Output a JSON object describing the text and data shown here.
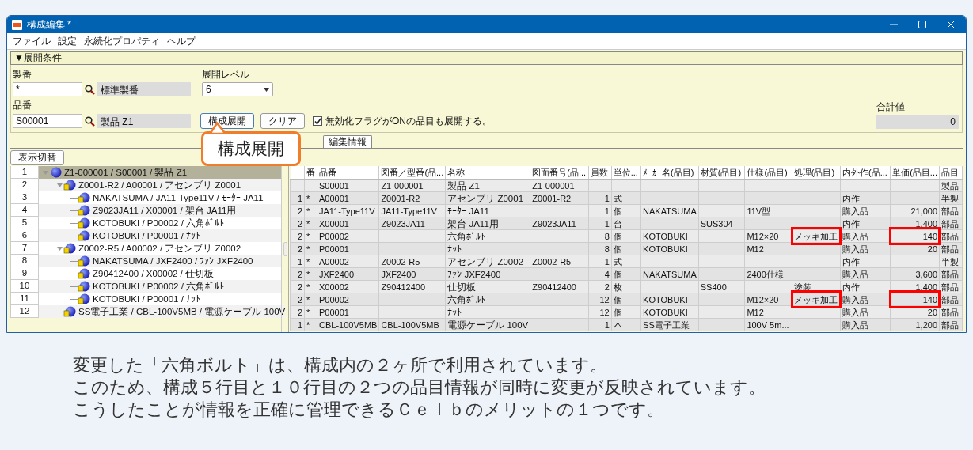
{
  "window": {
    "title": "構成編集 *"
  },
  "menu": [
    "ファイル",
    "設定",
    "永続化プロパティ",
    "ヘルプ"
  ],
  "conditions": {
    "header": "▼展開条件",
    "seiban": {
      "label": "製番",
      "value": "*",
      "name": "標準製番"
    },
    "level": {
      "label": "展開レベル",
      "value": "6"
    },
    "hinban": {
      "label": "品番",
      "value": "S00001",
      "name": "製品 Z1"
    },
    "buttons": [
      "構成展開",
      "クリア"
    ],
    "checkbox": {
      "label": "無効化フラグがONの品目も展開する。",
      "checked": true
    },
    "total": {
      "label": "合計値",
      "value": "0"
    }
  },
  "callout": {
    "text": "構成展開"
  },
  "tabs": [
    {
      "label": "編集情報",
      "selected": false
    }
  ],
  "toggle_button": "表示切替",
  "tree": [
    {
      "row": "1",
      "text": "Z1-000001 / S00001 / 製品 Z1",
      "kind": "product",
      "selected": true,
      "expanded": true,
      "children": [
        {
          "row": "2",
          "text": "Z0001-R2 / A00001 / アセンブリ Z0001",
          "kind": "part",
          "selected": false,
          "expanded": true,
          "children": [
            {
              "row": "3",
              "text": "NAKATSUMA / JA11-Type11V / ﾓｰﾀｰ JA11",
              "kind": "part",
              "selected": false
            },
            {
              "row": "4",
              "text": "Z9023JA11 / X00001 / 架台 JA11用",
              "kind": "part",
              "selected": false
            },
            {
              "row": "5",
              "text": "KOTOBUKI / P00002 / 六角ﾎﾞﾙﾄ",
              "kind": "part",
              "selected": false
            },
            {
              "row": "6",
              "text": "KOTOBUKI / P00001 / ﾅｯﾄ",
              "kind": "part",
              "selected": false
            }
          ]
        },
        {
          "row": "7",
          "text": "Z0002-R5 / A00002 / アセンブリ Z0002",
          "kind": "part",
          "selected": false,
          "expanded": true,
          "children": [
            {
              "row": "8",
              "text": "NAKATSUMA / JXF2400 / ﾌｧﾝ JXF2400",
              "kind": "part",
              "selected": false
            },
            {
              "row": "9",
              "text": "Z90412400 / X00002 / 仕切板",
              "kind": "part",
              "selected": false
            },
            {
              "row": "10",
              "text": "KOTOBUKI / P00002 / 六角ﾎﾞﾙﾄ",
              "kind": "part",
              "selected": false
            },
            {
              "row": "11",
              "text": "KOTOBUKI / P00001 / ﾅｯﾄ",
              "kind": "part",
              "selected": false
            }
          ]
        },
        {
          "row": "12",
          "text": "SS電子工業 / CBL-100V5MB / 電源ケーブル 100V",
          "kind": "part",
          "selected": false
        }
      ]
    }
  ],
  "table": {
    "columns": [
      null,
      "番",
      "品番",
      "図番／型番(品...",
      "名称",
      "図面番号(品...",
      "員数",
      "単位...",
      "ﾒｰｶｰ名(品目)",
      "材質(品目)",
      "仕様(品目)",
      "処理(品目)",
      "内外作(品...",
      "単価(品目...",
      "品目"
    ],
    "rows": [
      {
        "cells": [
          null,
          null,
          "S00001",
          "Z1-000001",
          "製品 Z1",
          "Z1-000001",
          null,
          null,
          null,
          null,
          null,
          null,
          null,
          null,
          "製品"
        ]
      },
      {
        "cells": [
          "1",
          "*",
          "A00001",
          "Z0001-R2",
          "アセンブリ Z0001",
          "Z0001-R2",
          "1",
          "式",
          null,
          null,
          null,
          null,
          "内作",
          null,
          "半製"
        ]
      },
      {
        "cells": [
          "2",
          "*",
          "JA11-Type11V",
          "JA11-Type11V",
          "ﾓｰﾀｰ JA11",
          null,
          "1",
          "個",
          "NAKATSUMA",
          null,
          "11V型",
          null,
          "購入品",
          "21,000",
          "部品"
        ]
      },
      {
        "cells": [
          "2",
          "*",
          "X00001",
          "Z9023JA11",
          "架台 JA11用",
          "Z9023JA11",
          "1",
          "台",
          null,
          "SUS304",
          null,
          null,
          "内作",
          "1,400",
          "部品"
        ]
      },
      {
        "cells": [
          "2",
          "*",
          "P00002",
          null,
          "六角ﾎﾞﾙﾄ",
          null,
          "8",
          "個",
          "KOTOBUKI",
          null,
          "M12×20",
          {
            "text": "メッキ加工",
            "highlighted": true
          },
          "購入品",
          {
            "text": "140",
            "highlighted": true
          },
          "部品"
        ]
      },
      {
        "cells": [
          "2",
          "*",
          "P00001",
          null,
          "ﾅｯﾄ",
          null,
          "8",
          "個",
          "KOTOBUKI",
          null,
          "M12",
          null,
          "購入品",
          "20",
          "部品"
        ]
      },
      {
        "cells": [
          "1",
          "*",
          "A00002",
          "Z0002-R5",
          "アセンブリ Z0002",
          "Z0002-R5",
          "1",
          "式",
          null,
          null,
          null,
          null,
          "内作",
          null,
          "半製"
        ]
      },
      {
        "cells": [
          "2",
          "*",
          "JXF2400",
          "JXF2400",
          "ﾌｧﾝ JXF2400",
          null,
          "4",
          "個",
          "NAKATSUMA",
          null,
          "2400仕様",
          null,
          "購入品",
          "3,600",
          "部品"
        ]
      },
      {
        "cells": [
          "2",
          "*",
          "X00002",
          "Z90412400",
          "仕切板",
          "Z90412400",
          "2",
          "枚",
          null,
          "SS400",
          null,
          "塗装",
          "内作",
          "1,400",
          "部品"
        ]
      },
      {
        "cells": [
          "2",
          "*",
          "P00002",
          null,
          "六角ﾎﾞﾙﾄ",
          null,
          "12",
          "個",
          "KOTOBUKI",
          null,
          "M12×20",
          {
            "text": "メッキ加工",
            "highlighted": true
          },
          "購入品",
          {
            "text": "140",
            "highlighted": true
          },
          "部品"
        ]
      },
      {
        "cells": [
          "2",
          "*",
          "P00001",
          null,
          "ﾅｯﾄ",
          null,
          "12",
          "個",
          "KOTOBUKI",
          null,
          "M12",
          null,
          "購入品",
          "20",
          "部品"
        ]
      },
      {
        "cells": [
          "1",
          "*",
          "CBL-100V5MB",
          "CBL-100V5MB",
          "電源ケーブル 100V",
          null,
          "1",
          "本",
          "SS電子工業",
          null,
          "100V 5m...",
          null,
          "購入品",
          "1,200",
          "部品"
        ]
      }
    ]
  },
  "caption": [
    "変更した「六角ボルト」は、構成内の２ヶ所で利用されています。",
    "このため、構成５行目と１０行目の２つの品目情報が同時に変更が反映されています。",
    "こうしたことが情報を正確に管理できるＣｅｌｂのメリットの１つです。"
  ]
}
